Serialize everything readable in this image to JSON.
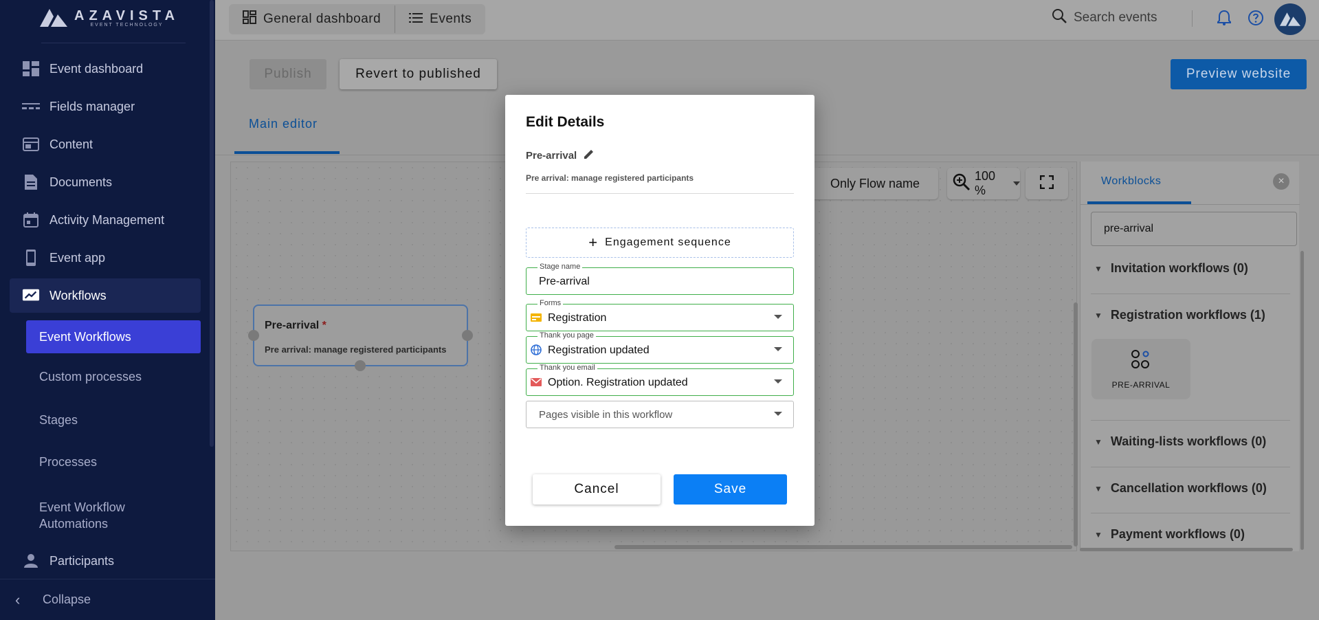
{
  "app": {
    "brand": "AZAVISTA",
    "brand_sub": "EVENT TECHNOLOGY"
  },
  "sidebar": {
    "items": [
      {
        "label": "Event dashboard",
        "icon": "dashboard-icon"
      },
      {
        "label": "Fields manager",
        "icon": "fields-icon"
      },
      {
        "label": "Content",
        "icon": "content-icon"
      },
      {
        "label": "Documents",
        "icon": "document-icon"
      },
      {
        "label": "Activity Management",
        "icon": "calendar-icon"
      },
      {
        "label": "Event app",
        "icon": "phone-icon"
      },
      {
        "label": "Workflows",
        "icon": "workflow-icon"
      }
    ],
    "sub_items": [
      {
        "label": "Event Workflows"
      },
      {
        "label": "Custom processes"
      },
      {
        "label": "Stages"
      },
      {
        "label": "Processes"
      },
      {
        "label": "Event Workflow",
        "label2": "Automations"
      }
    ],
    "participants": "Participants",
    "collapse": "Collapse"
  },
  "topbar": {
    "general_dashboard": "General dashboard",
    "events": "Events",
    "search_placeholder": "Search events"
  },
  "editor": {
    "publish": "Publish",
    "revert": "Revert to published",
    "preview": "Preview website",
    "main_tab": "Main editor",
    "only_flow_name": "Only Flow name",
    "zoom": "100 %",
    "node": {
      "title": "Pre-arrival",
      "required_mark": "*",
      "description": "Pre arrival: manage registered participants"
    }
  },
  "workblocks": {
    "tab": "Workblocks",
    "search_value": "pre-arrival",
    "groups": [
      {
        "label": "Invitation workflows (0)"
      },
      {
        "label": "Registration workflows (1)"
      },
      {
        "label": "Waiting-lists workflows (0)"
      },
      {
        "label": "Cancellation workflows (0)"
      },
      {
        "label": "Payment workflows (0)"
      }
    ],
    "card_label": "PRE-ARRIVAL"
  },
  "modal": {
    "title": "Edit Details",
    "stage": "Pre-arrival",
    "description": "Pre arrival: manage registered participants",
    "engagement": "Engagement sequence",
    "fields": {
      "stage_name_label": "Stage name",
      "stage_name_value": "Pre-arrival",
      "forms_label": "Forms",
      "forms_value": "Registration",
      "thankyou_page_label": "Thank you page",
      "thankyou_page_value": "Registration updated",
      "thankyou_email_label": "Thank you email",
      "thankyou_email_value": "Option. Registration updated",
      "pages_placeholder": "Pages visible in this workflow"
    },
    "cancel": "Cancel",
    "save": "Save"
  },
  "colors": {
    "sidebar_bg": "#0e1a3f",
    "active_sub": "#3a3fd6",
    "accent": "#0b7ff5",
    "valid_border": "#3fae49"
  }
}
